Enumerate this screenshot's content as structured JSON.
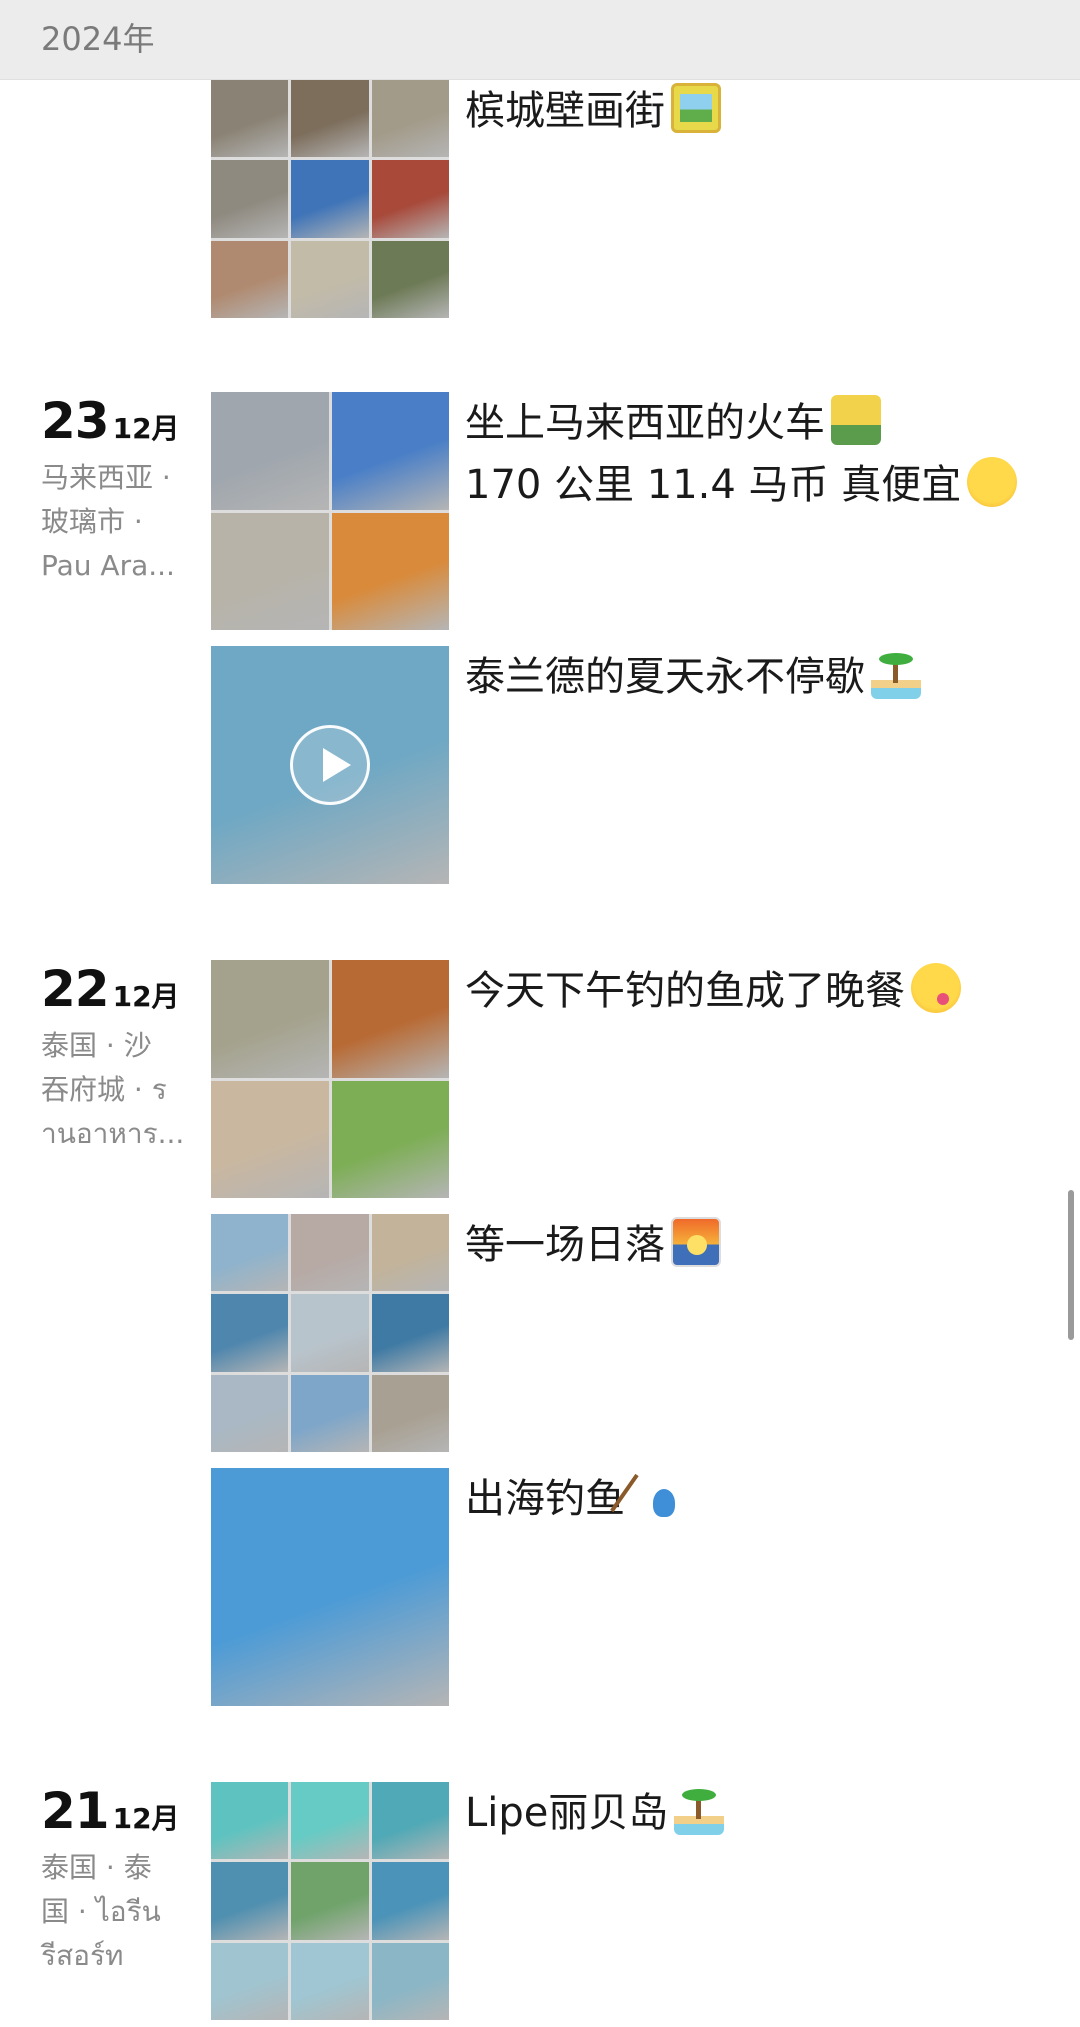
{
  "year_header": "2024年",
  "days": [
    {
      "id": "top",
      "posts": [
        {
          "caption": "槟城壁画街",
          "emoji": "framed-picture-emoji",
          "layout": "3x3",
          "colors": [
            "#8a8274",
            "#7d6e5c",
            "#a39b8a",
            "#8f8a80",
            "#3f74b8",
            "#a8493a",
            "#b08a70",
            "#c2bba8",
            "#6d7a56"
          ]
        }
      ]
    },
    {
      "id": "dec23",
      "day": "23",
      "month": "12月",
      "location_lines": [
        "马来西亚 ·",
        "玻璃市 ·",
        "Pau Ara..."
      ],
      "posts": [
        {
          "caption_lines": [
            "坐上马来西亚的火车",
            "170 公里 11.4 马币 真便宜"
          ],
          "emojis": [
            "train-emoji",
            "star-struck-emoji"
          ],
          "layout": "2x2",
          "colors": [
            "#9fa6ad",
            "#4a7fc7",
            "#b7b3a8",
            "#d98a3a"
          ]
        },
        {
          "caption": "泰兰德的夏天永不停歇",
          "emoji": "island-emoji",
          "layout": "video",
          "colors": [
            "#6fa8c4"
          ]
        }
      ]
    },
    {
      "id": "dec22",
      "day": "22",
      "month": "12月",
      "location_lines": [
        "泰国 · 沙",
        "吞府城 · ร",
        "านอาหาร..."
      ],
      "posts": [
        {
          "caption": "今天下午钓的鱼成了晚餐",
          "emoji": "yum-emoji",
          "layout": "2x2",
          "colors": [
            "#a4a28c",
            "#b86a34",
            "#c9b7a0",
            "#7dae55"
          ]
        },
        {
          "caption": "等一场日落",
          "emoji": "sunrise-emoji",
          "layout": "3x3",
          "colors": [
            "#8fb3cc",
            "#b7a9a4",
            "#c2b39a",
            "#4f86ad",
            "#b8c4cc",
            "#3f7aa4",
            "#a9b8c4",
            "#7ea6c9",
            "#a8a092"
          ]
        },
        {
          "caption": "出海钓鱼",
          "emoji": "fishing-emoji",
          "layout": "single",
          "colors": [
            "#4d9bd6"
          ]
        }
      ]
    },
    {
      "id": "dec21",
      "day": "21",
      "month": "12月",
      "location_lines": [
        "泰国 · 泰",
        "国 · ไอรีน",
        "รีสอร์ท"
      ],
      "posts": [
        {
          "caption": "Lipe丽贝岛",
          "emoji": "island-emoji",
          "layout": "3x3",
          "colors": [
            "#5ec3c0",
            "#66cbc4",
            "#4fa9b6",
            "#4f8fb0",
            "#6fa36a",
            "#4b93b8",
            "#a0c4d0",
            "#9fc6d2",
            "#8ab6c6"
          ]
        }
      ]
    }
  ]
}
